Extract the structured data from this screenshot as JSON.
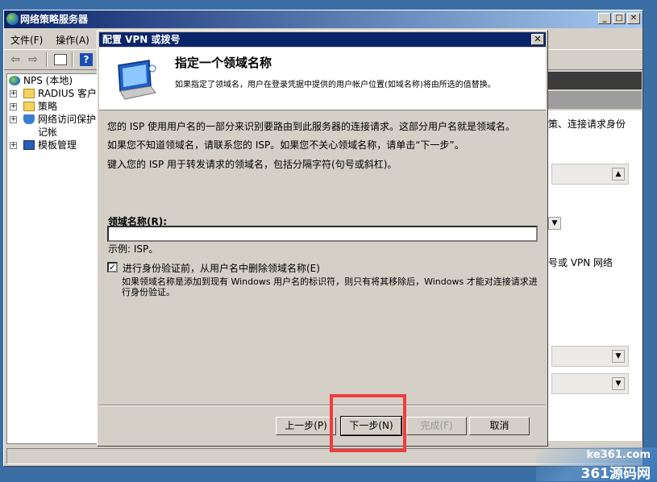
{
  "main_window": {
    "title": "网络策略服务器",
    "menu": [
      "文件(F)",
      "操作(A)"
    ],
    "tree": [
      {
        "label": "NPS (本地)"
      },
      {
        "label": "RADIUS 客户端"
      },
      {
        "label": "策略"
      },
      {
        "label": "网络访问保护"
      },
      {
        "label": "记帐"
      },
      {
        "label": "模板管理"
      }
    ],
    "right_text_1": "策、连接请求身份",
    "right_text_2": "号或 VPN 网络"
  },
  "dialog": {
    "title": "配置 VPN 或拨号",
    "header_title": "指定一个领域名称",
    "header_subtitle": "如果指定了领域名，用户在登录凭据中提供的用户帐户位置(如域名称)将由所选的值替换。",
    "para1": "您的 ISP 使用用户名的一部分来识别要路由到此服务器的连接请求。这部分用户名就是领域名。",
    "para2": "如果您不知道领域名，请联系您的 ISP。如果您不关心领域名称，请单击“下一步”。",
    "para3": "键入您的 ISP 用于转发请求的领域名，包括分隔字符(句号或斜杠)。",
    "domain_label": "领域名称(R):",
    "domain_value": "",
    "example": "示例: ISP。",
    "checkbox_label": "进行身份验证前，从用户名中删除领域名称(E)",
    "checkbox_checked": true,
    "checkbox_mark": "✓",
    "checkbox_desc": "如果领域名称是添加到现有 Windows 用户名的标识符，则只有将其移除后，Windows 才能对连接请求进行身份验证。",
    "buttons": {
      "back": "上一步(P)",
      "next": "下一步(N)",
      "finish": "完成(F)",
      "cancel": "取消"
    }
  },
  "watermark": {
    "domain": "ke361.com",
    "name": "361源码网"
  },
  "colors": {
    "desktop": "#3a6ea5",
    "title_active": "#0a246a",
    "highlight": "#f23b3b"
  }
}
